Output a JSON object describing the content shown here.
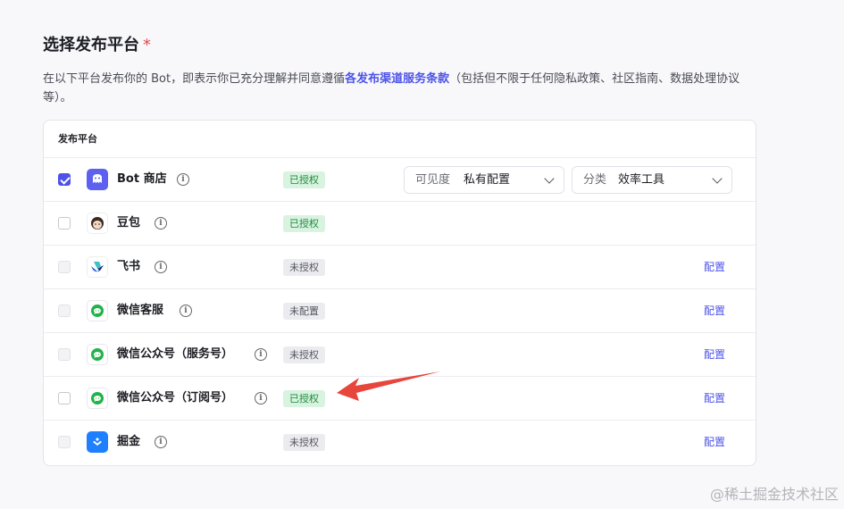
{
  "section": {
    "title": "选择发布平台",
    "required_mark": "*",
    "desc_prefix": "在以下平台发布你的 Bot，即表示你已充分理解并同意遵循",
    "desc_link": "各发布渠道服务条款",
    "desc_suffix": "（包括但不限于任何隐私政策、社区指南、数据处理协议等）。"
  },
  "table": {
    "header": "发布平台",
    "rows": [
      {
        "name": "Bot 商店",
        "status": "已授权",
        "checked": true,
        "disabled": false
      },
      {
        "name": "豆包",
        "status": "已授权",
        "checked": false,
        "disabled": false
      },
      {
        "name": "飞书",
        "status": "未授权",
        "checked": false,
        "disabled": true,
        "action": "配置"
      },
      {
        "name": "微信客服",
        "status": "未配置",
        "checked": false,
        "disabled": true,
        "action": "配置"
      },
      {
        "name": "微信公众号（服务号）",
        "status": "未授权",
        "checked": false,
        "disabled": true,
        "action": "配置"
      },
      {
        "name": "微信公众号（订阅号）",
        "status": "已授权",
        "checked": false,
        "disabled": false,
        "action": "配置"
      },
      {
        "name": "掘金",
        "status": "未授权",
        "checked": false,
        "disabled": true,
        "action": "配置"
      }
    ]
  },
  "bot_store": {
    "visibility_label": "可见度",
    "visibility_value": "私有配置",
    "category_label": "分类",
    "category_value": "效率工具"
  },
  "info_glyph": "i",
  "watermark": "@稀土掘金技术社区",
  "colors": {
    "accent": "#4d53e8",
    "ok_bg": "#d8f3df",
    "ok_fg": "#1f8a3d",
    "arrow": "#e8453c"
  }
}
